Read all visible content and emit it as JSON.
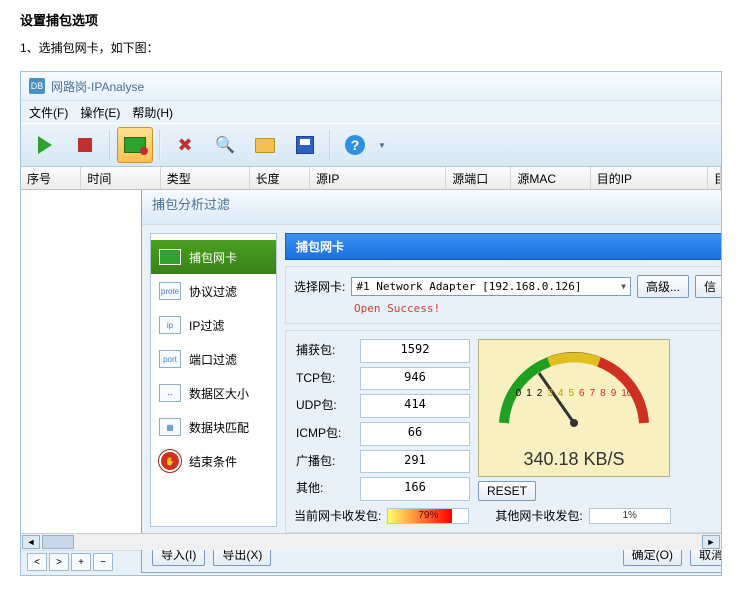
{
  "doc": {
    "title": "设置捕包选项",
    "step1": "1、选捕包网卡，如下图："
  },
  "app": {
    "title": "网路岗-IPAnalyse",
    "title_icon": "DB"
  },
  "menu": {
    "file": "文件(F)",
    "operate": "操作(E)",
    "help": "帮助(H)"
  },
  "columns": {
    "seq": "序号",
    "time": "时间",
    "type": "类型",
    "length": "长度",
    "src_ip": "源IP",
    "src_port": "源端口",
    "src_mac": "源MAC",
    "dst_ip": "目的IP",
    "dst_port": "目的端口"
  },
  "dialog": {
    "title": "捕包分析过滤",
    "sidebar": {
      "nic": "捕包网卡",
      "proto": "协议过滤",
      "ip": "IP过滤",
      "port": "端口过滤",
      "size": "数据区大小",
      "match": "数据块匹配",
      "end": "结束条件",
      "icon_proto": "prote",
      "icon_ip": "ip",
      "icon_port": "port",
      "icon_size": "↔",
      "icon_match": "▦"
    },
    "panel_title": "捕包网卡",
    "nic_label": "选择网卡:",
    "nic_value": "#1 Network Adapter [192.168.0.126]",
    "btn_adv": "高级...",
    "btn_info": "信",
    "status": "Open Success!",
    "stats": {
      "captured_lbl": "捕获包:",
      "captured": "1592",
      "tcp_lbl": "TCP包:",
      "tcp": "946",
      "udp_lbl": "UDP包:",
      "udp": "414",
      "icmp_lbl": "ICMP包:",
      "icmp": "66",
      "broadcast_lbl": "广播包:",
      "broadcast": "291",
      "other_lbl": "其他:",
      "other": "166"
    },
    "gauge": {
      "speed": "340.18 KB/S"
    },
    "reset": "RESET",
    "rx_current_lbl": "当前网卡收发包:",
    "rx_current_val": "79%",
    "rx_other_lbl": "其他网卡收发包:",
    "rx_other_val": "1%",
    "btn_import": "导入(I)",
    "btn_export": "导出(X)",
    "btn_ok": "确定(O)",
    "btn_cancel": "取消"
  }
}
